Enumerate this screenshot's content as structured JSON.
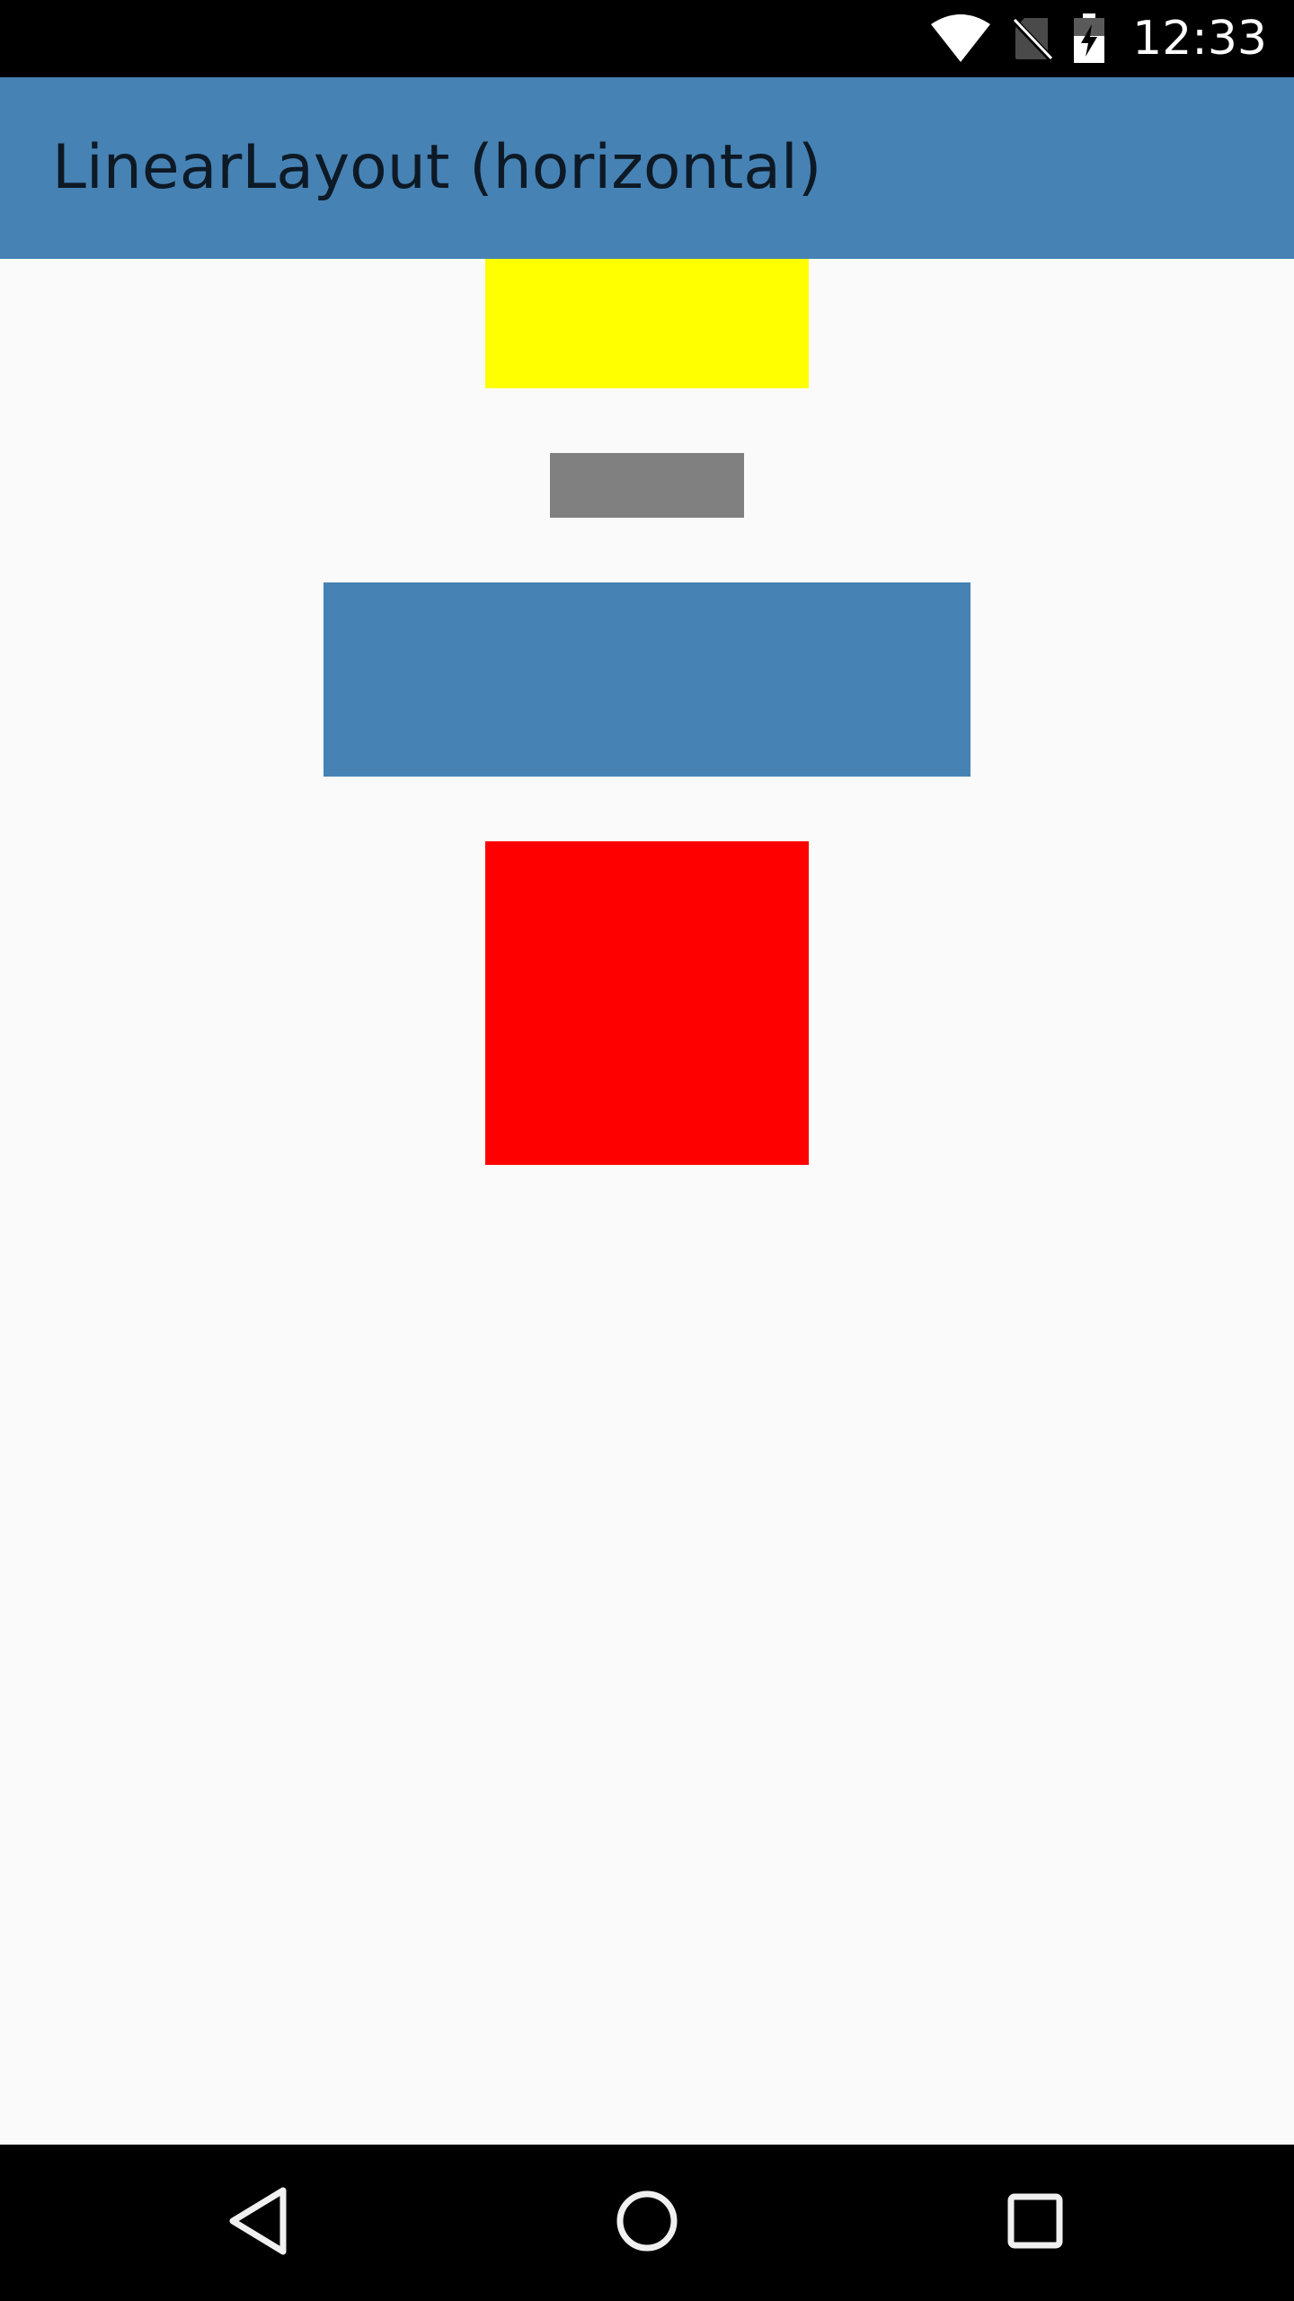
{
  "status_bar": {
    "time": "12:33",
    "icons": [
      "wifi-icon",
      "no-sim-icon",
      "battery-charging-icon"
    ]
  },
  "app_bar": {
    "title": "LinearLayout (horizontal)"
  },
  "boxes": [
    {
      "name": "yellow-box",
      "color": "#ffff00"
    },
    {
      "name": "gray-box",
      "color": "#808080"
    },
    {
      "name": "blue-box",
      "color": "#4682b4"
    },
    {
      "name": "red-box",
      "color": "#ff0000"
    }
  ],
  "nav_bar": {
    "buttons": [
      "back-icon",
      "home-icon",
      "recent-apps-icon"
    ]
  },
  "colors": {
    "app_bar": "#4682b4",
    "background": "#fafafa",
    "system_bars": "#000000"
  }
}
